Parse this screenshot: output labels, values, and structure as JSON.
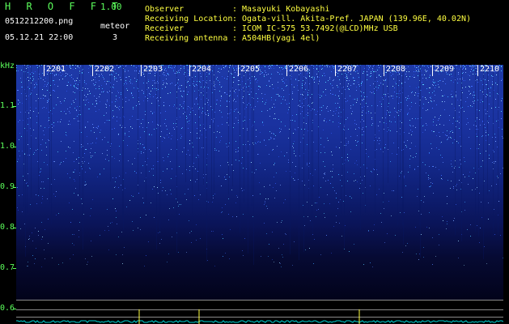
{
  "app": {
    "brand": "H R O F F T",
    "version": "1.00"
  },
  "session": {
    "filename": "0512212200.png",
    "datetime": "05.12.21 22:00",
    "meteor_label": "meteor",
    "meteor_count": "3"
  },
  "station": [
    {
      "label": "Observer",
      "value": ": Masayuki Kobayashi"
    },
    {
      "label": "Receiving Location",
      "value": ": Ogata-vill. Akita-Pref. JAPAN (139.96E, 40.02N)"
    },
    {
      "label": "Receiver",
      "value": ": ICOM IC-575 53.7492(@LCD)MHz USB"
    },
    {
      "label": "Receiving antenna",
      "value": ": A504HB(yagi 4el)"
    }
  ],
  "axis": {
    "unit": "kHz",
    "y_ticks": [
      "1.1",
      "1.0",
      "0.9",
      "0.8",
      "0.7",
      "0.6"
    ],
    "x_ticks": [
      "2201",
      "2202",
      "2203",
      "2204",
      "2205",
      "2206",
      "2207",
      "2208",
      "2209",
      "2210"
    ]
  },
  "colors": {
    "label_green": "#5cff5c",
    "label_yellow": "#ffff40",
    "spectrogram_blue": "#1e3aa8",
    "signal_cyan": "#00d0d0"
  }
}
